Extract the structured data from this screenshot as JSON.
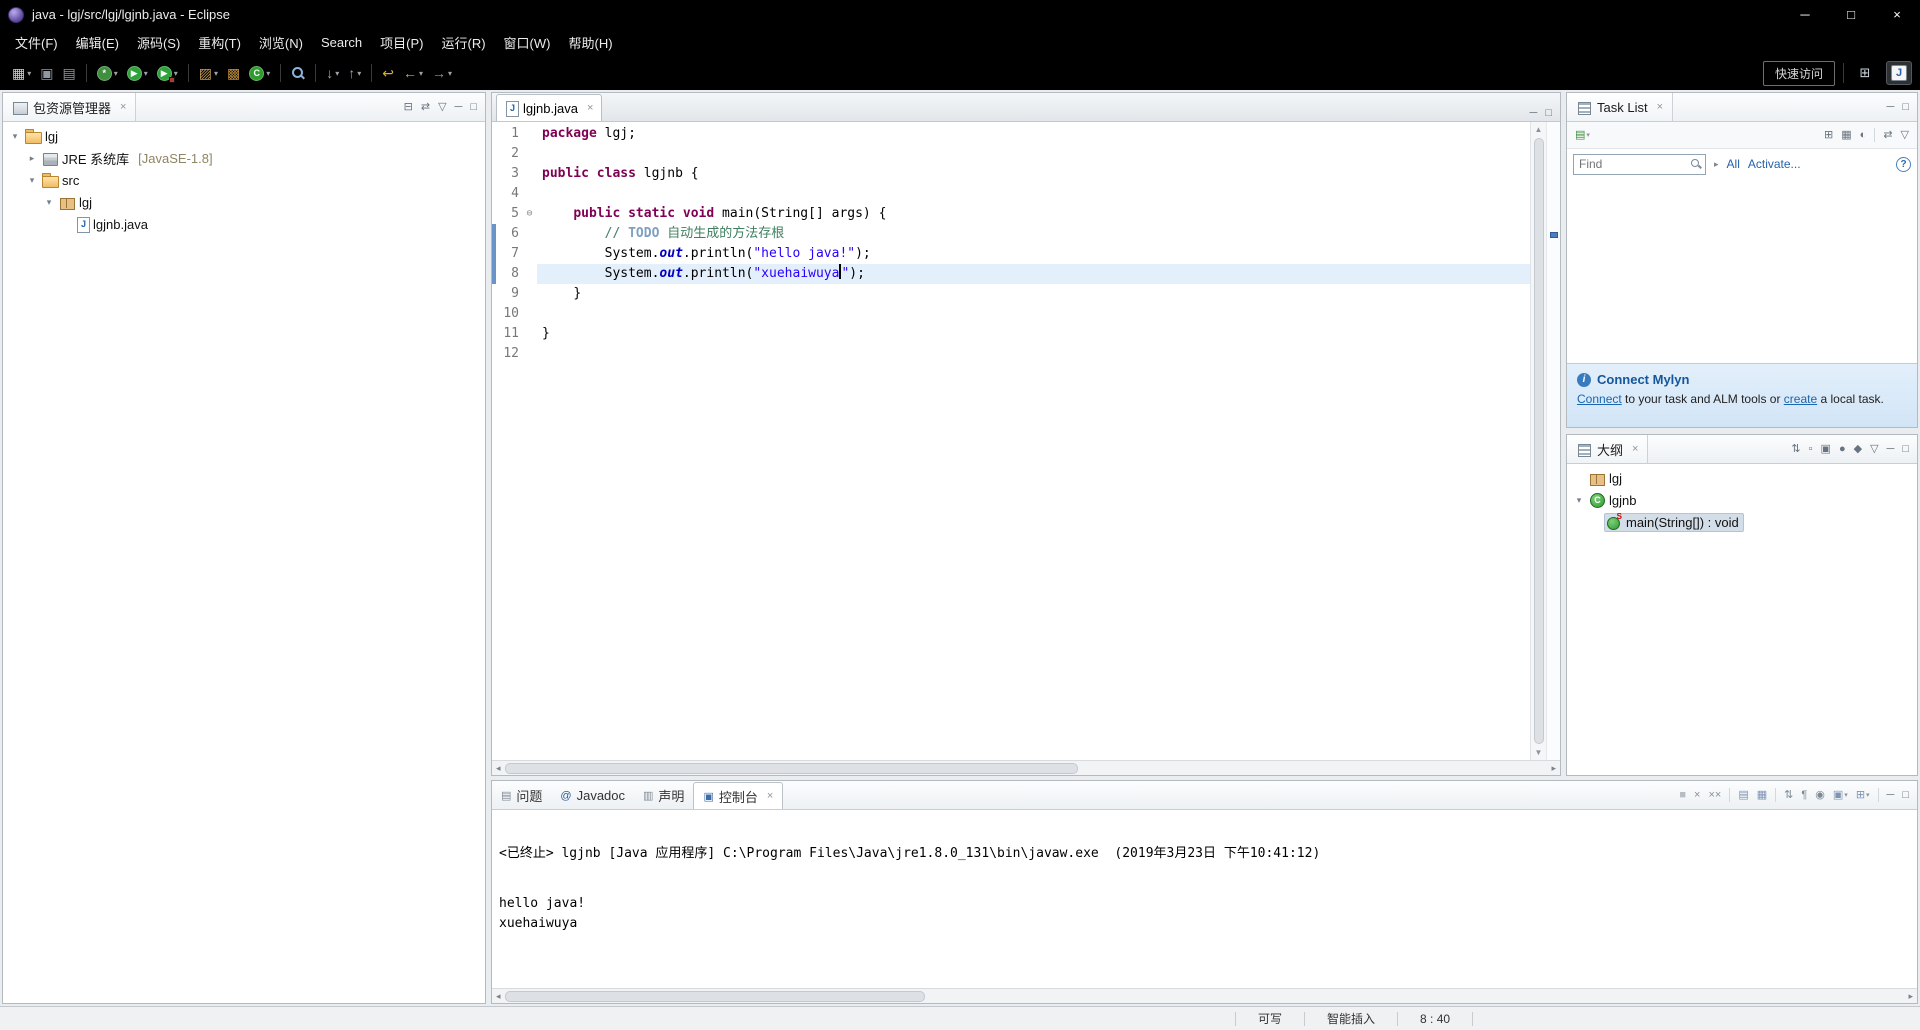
{
  "window": {
    "title": "java - lgj/src/lgj/lgjnb.java - Eclipse",
    "controls": [
      {
        "name": "minimize",
        "glyph": "─"
      },
      {
        "name": "maximize",
        "glyph": "□"
      },
      {
        "name": "close",
        "glyph": "×"
      }
    ]
  },
  "icons": {
    "close": "×",
    "dropdown": "▾",
    "expander_open": "▾",
    "expander_closed": "▸",
    "fold_collapse": "⊖",
    "info": "i",
    "help": "?",
    "find_chevron": "▸"
  },
  "menu": {
    "items": [
      {
        "name": "file",
        "label": "文件(F)"
      },
      {
        "name": "edit",
        "label": "编辑(E)"
      },
      {
        "name": "source",
        "label": "源码(S)"
      },
      {
        "name": "refactor",
        "label": "重构(T)"
      },
      {
        "name": "navigate",
        "label": "浏览(N)"
      },
      {
        "name": "search",
        "label": "Search"
      },
      {
        "name": "project",
        "label": "项目(P)"
      },
      {
        "name": "run",
        "label": "运行(R)"
      },
      {
        "name": "window",
        "label": "窗口(W)"
      },
      {
        "name": "help",
        "label": "帮助(H)"
      }
    ]
  },
  "toolbar": {
    "quick_access": "快速访问",
    "buttons": [
      {
        "name": "new-wizard",
        "glyph": "▦",
        "color": "#c8cfd6",
        "dd": true
      },
      {
        "name": "save",
        "glyph": "▣",
        "color": "#8f99a3"
      },
      {
        "name": "print",
        "glyph": "▤",
        "color": "#8f99a3"
      },
      {
        "sep": true
      },
      {
        "name": "debug",
        "type": "circle",
        "glyph": "*",
        "bg": "#3f8f3f",
        "dd": true
      },
      {
        "name": "run",
        "type": "circle",
        "glyph": "▶",
        "bg": "#2fa23a",
        "dd": true
      },
      {
        "name": "run-external-tools",
        "type": "circle",
        "glyph": "▶",
        "bg": "#2fa23a",
        "badge": "#b03a2e",
        "dd": true
      },
      {
        "sep": true
      },
      {
        "name": "new-java-project",
        "glyph": "▨",
        "color": "#c39b55",
        "dd": true
      },
      {
        "name": "new-java-package",
        "glyph": "▩",
        "color": "#b98a3e"
      },
      {
        "name": "new-java-class",
        "type": "circle",
        "glyph": "C",
        "bg": "#2f9b2f",
        "dd": true
      },
      {
        "sep": true
      },
      {
        "name": "open-search",
        "type": "mag"
      },
      {
        "sep": true
      },
      {
        "name": "next-annotation",
        "glyph": "↓",
        "color": "#97a1ab",
        "dd": true
      },
      {
        "name": "previous-annotation",
        "glyph": "↑",
        "color": "#97a1ab",
        "dd": true
      },
      {
        "sep": true
      },
      {
        "name": "last-edit-location",
        "glyph": "↩",
        "color": "#d2af3a"
      },
      {
        "name": "back",
        "glyph": "←",
        "color": "#d2af3a",
        "dd": true
      },
      {
        "name": "forward",
        "glyph": "→",
        "color": "#8f99a3",
        "dd": true
      }
    ]
  },
  "package_explorer": {
    "title": "包资源管理器",
    "toolbar": [
      {
        "name": "collapse-all",
        "glyph": "⊟"
      },
      {
        "name": "link-with-editor",
        "glyph": "⇄"
      },
      {
        "name": "view-menu",
        "glyph": "▽"
      },
      {
        "name": "minimize",
        "glyph": "─"
      },
      {
        "name": "maximize",
        "glyph": "□"
      }
    ],
    "tree": [
      {
        "name": "project-lgj",
        "label": "lgj",
        "level": 0,
        "expander": "open",
        "icon": "project"
      },
      {
        "name": "jre-system-library",
        "label": "JRE 系统库",
        "suffix": "[JavaSE-1.8]",
        "level": 1,
        "expander": "closed",
        "icon": "library"
      },
      {
        "name": "src-folder",
        "label": "src",
        "level": 1,
        "expander": "open",
        "icon": "src"
      },
      {
        "name": "package-lgj",
        "label": "lgj",
        "level": 2,
        "expander": "open",
        "icon": "package"
      },
      {
        "name": "file-lgjnb-java",
        "label": "lgjnb.java",
        "level": 3,
        "expander": "none",
        "icon": "java-file"
      }
    ]
  },
  "editor": {
    "tab": {
      "label": "lgjnb.java"
    },
    "toolbar": [
      {
        "name": "minimize",
        "glyph": "─"
      },
      {
        "name": "maximize",
        "glyph": "□"
      }
    ],
    "lines": [
      {
        "n": 1,
        "tokens": [
          [
            "k",
            "package"
          ],
          [
            "pl",
            " lgj;"
          ]
        ]
      },
      {
        "n": 2,
        "tokens": []
      },
      {
        "n": 3,
        "tokens": [
          [
            "k",
            "public"
          ],
          [
            "pl",
            " "
          ],
          [
            "k",
            "class"
          ],
          [
            "pl",
            " lgjnb {"
          ]
        ]
      },
      {
        "n": 4,
        "tokens": []
      },
      {
        "n": 5,
        "fold": true,
        "tokens": [
          [
            "pl",
            "\t"
          ],
          [
            "k",
            "public"
          ],
          [
            "pl",
            " "
          ],
          [
            "k",
            "static"
          ],
          [
            "pl",
            " "
          ],
          [
            "k",
            "void"
          ],
          [
            "pl",
            " main(String[] args) {"
          ]
        ]
      },
      {
        "n": 6,
        "diff": true,
        "tokens": [
          [
            "pl",
            "\t\t"
          ],
          [
            "c",
            "// "
          ],
          [
            "td",
            "TODO"
          ],
          [
            "c",
            " 自动生成的方法存根"
          ]
        ]
      },
      {
        "n": 7,
        "diff": true,
        "tokens": [
          [
            "pl",
            "\t\t"
          ],
          [
            "pl",
            "System."
          ],
          [
            "sf",
            "out"
          ],
          [
            "pl",
            ".println("
          ],
          [
            "s",
            "\"hello java!\""
          ],
          [
            "pl",
            ");"
          ]
        ]
      },
      {
        "n": 8,
        "diff": true,
        "current": true,
        "tokens": [
          [
            "pl",
            "\t\t"
          ],
          [
            "pl",
            "System."
          ],
          [
            "sf",
            "out"
          ],
          [
            "pl",
            ".println("
          ],
          [
            "s",
            "\"xuehaiwuya"
          ],
          [
            "cur",
            ""
          ],
          [
            "s",
            "\""
          ],
          [
            "pl",
            ");"
          ]
        ]
      },
      {
        "n": 9,
        "tokens": [
          [
            "pl",
            "\t}"
          ]
        ]
      },
      {
        "n": 10,
        "tokens": []
      },
      {
        "n": 11,
        "tokens": [
          [
            "pl",
            "}"
          ]
        ]
      },
      {
        "n": 12,
        "tokens": []
      }
    ]
  },
  "task_list": {
    "title": "Task List",
    "header_tools": [
      {
        "name": "minimize",
        "glyph": "─"
      },
      {
        "name": "maximize",
        "glyph": "□"
      }
    ],
    "toolbar_left": [
      {
        "name": "new-task",
        "glyph": "▤",
        "color": "#3f8f3f",
        "dd": true
      }
    ],
    "toolbar_right": [
      {
        "name": "categorized-view",
        "glyph": "⊞"
      },
      {
        "name": "scheduled-view",
        "glyph": "▦"
      },
      {
        "name": "focus-on-workweek",
        "glyph": "◐"
      },
      {
        "sep": true
      },
      {
        "name": "link-with-editor",
        "glyph": "⇄"
      },
      {
        "name": "view-menu",
        "glyph": "▽"
      }
    ],
    "find_placeholder": "Find",
    "all_label": "All",
    "activate_label": "Activate...",
    "mylyn": {
      "title": "Connect Mylyn",
      "segments": [
        {
          "name": "connect-link",
          "text": "Connect",
          "link": true
        },
        {
          "text": " to your task and ALM tools or "
        },
        {
          "name": "create-link",
          "text": "create",
          "link": true
        },
        {
          "text": " a local task."
        }
      ]
    }
  },
  "outline": {
    "title": "大纲",
    "toolbar": [
      {
        "name": "sort",
        "glyph": "⇅"
      },
      {
        "name": "hide-fields",
        "glyph": "▫"
      },
      {
        "name": "hide-static-members",
        "glyph": "▣"
      },
      {
        "name": "hide-non-public",
        "glyph": "●"
      },
      {
        "name": "hide-local-types",
        "glyph": "◆"
      },
      {
        "name": "view-menu",
        "glyph": "▽"
      },
      {
        "name": "minimize",
        "glyph": "─"
      },
      {
        "name": "maximize",
        "glyph": "□"
      }
    ],
    "tree": [
      {
        "name": "package-declaration-lgj",
        "label": "lgj",
        "level": 0,
        "expander": "none",
        "icon": "package"
      },
      {
        "name": "class-lgjnb",
        "label": "lgjnb",
        "level": 0,
        "expander": "open",
        "icon": "class"
      },
      {
        "name": "method-main",
        "label": "main(String[]) : void",
        "level": 1,
        "expander": "none",
        "icon": "method-static",
        "selected": true
      }
    ]
  },
  "console": {
    "tabs": [
      {
        "name": "problems",
        "label": "问题",
        "glyph": "▤",
        "color": "#808a94"
      },
      {
        "name": "javadoc",
        "label": "Javadoc",
        "glyph": "@",
        "color": "#2a6099"
      },
      {
        "name": "declaration",
        "label": "声明",
        "glyph": "▥",
        "color": "#808a94"
      },
      {
        "name": "console",
        "label": "控制台",
        "glyph": "▣",
        "color": "#3c6ea5",
        "active": true,
        "closable": true
      }
    ],
    "toolbar": [
      {
        "name": "terminate",
        "glyph": "■",
        "color": "#b6bcc2"
      },
      {
        "name": "remove-launch",
        "glyph": "×",
        "color": "#8a9098"
      },
      {
        "name": "remove-all-launches",
        "glyph": "××",
        "color": "#8a9098"
      },
      {
        "sep": true
      },
      {
        "name": "save-output",
        "glyph": "▤",
        "color": "#7d94b5"
      },
      {
        "name": "clear-console",
        "glyph": "▦",
        "color": "#7d94b5"
      },
      {
        "sep": true
      },
      {
        "name": "scroll-lock",
        "glyph": "⇅",
        "color": "#7d8a96"
      },
      {
        "name": "word-wrap",
        "glyph": "¶",
        "color": "#7d8a96"
      },
      {
        "name": "pin-console",
        "glyph": "◉",
        "color": "#7d8a96"
      },
      {
        "name": "display-selected-console",
        "glyph": "▣",
        "color": "#7d94b5",
        "dd": true
      },
      {
        "name": "open-console",
        "glyph": "⊞",
        "color": "#7d94b5",
        "dd": true
      },
      {
        "sep": true
      },
      {
        "name": "minimize",
        "glyph": "─",
        "color": "#6f7780"
      },
      {
        "name": "maximize",
        "glyph": "□",
        "color": "#6f7780"
      }
    ],
    "banner": "<已终止> lgjnb [Java 应用程序] C:\\Program Files\\Java\\jre1.8.0_131\\bin\\javaw.exe  (2019年3月23日 下午10:41:12)",
    "output": [
      "hello java!",
      "xuehaiwuya"
    ]
  },
  "statusbar": {
    "items": [
      {
        "name": "writable",
        "label": "可写"
      },
      {
        "name": "insert-mode",
        "label": "智能插入"
      },
      {
        "name": "cursor-position",
        "label": "8 : 40"
      }
    ]
  }
}
